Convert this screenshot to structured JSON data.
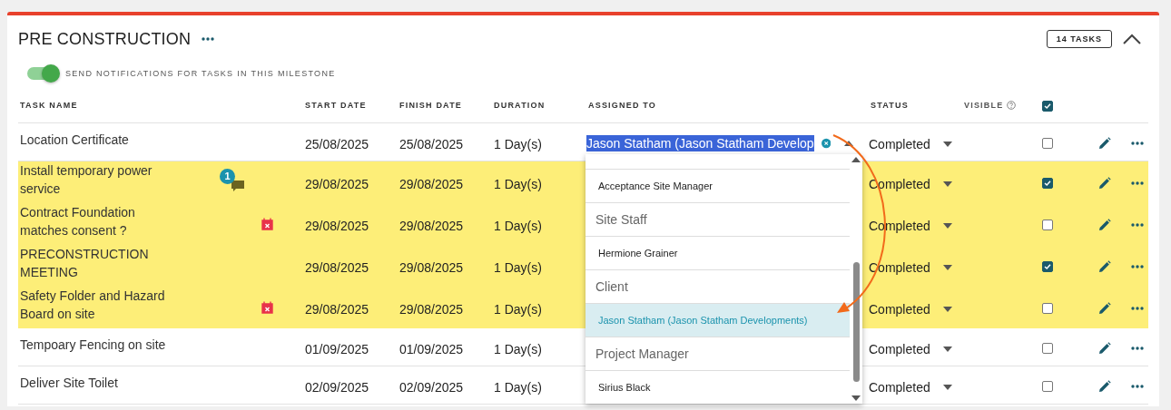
{
  "milestone": {
    "title": "PRE CONSTRUCTION",
    "task_count": "14 TASKS",
    "expanded": true
  },
  "notifications": {
    "label": "SEND NOTIFICATIONS FOR TASKS IN THIS MILESTONE",
    "on": true
  },
  "table": {
    "columns": [
      "TASK NAME",
      "START DATE",
      "FINISH DATE",
      "DURATION",
      "ASSIGNED TO",
      "STATUS",
      "VISIBLE"
    ],
    "visible_all_checked": true,
    "rows": [
      {
        "name": "Location Certificate",
        "start": "25/08/2025",
        "finish": "25/08/2025",
        "duration": "1 Day(s)",
        "status": "Completed",
        "visible": false,
        "highlighted": false,
        "kind": "plain",
        "assigned": "Jason Statham (Jason Statham Develop"
      },
      {
        "name": "Install temporary power service",
        "start": "29/08/2025",
        "finish": "29/08/2025",
        "duration": "1 Day(s)",
        "status": "Completed",
        "visible": true,
        "highlighted": true,
        "kind": "commented",
        "comment_count": "1"
      },
      {
        "name": "Contract Foundation matches consent ?",
        "start": "29/08/2025",
        "finish": "29/08/2025",
        "duration": "1 Day(s)",
        "status": "Completed",
        "visible": false,
        "highlighted": true,
        "kind": "overdue"
      },
      {
        "name": "PRECONSTRUCTION MEETING",
        "start": "29/08/2025",
        "finish": "29/08/2025",
        "duration": "1 Day(s)",
        "status": "Completed",
        "visible": true,
        "highlighted": true,
        "kind": "plain"
      },
      {
        "name": "Safety Folder and Hazard Board on site",
        "start": "29/08/2025",
        "finish": "29/08/2025",
        "duration": "1 Day(s)",
        "status": "Completed",
        "visible": false,
        "highlighted": true,
        "kind": "overdue"
      },
      {
        "name": "Tempoary Fencing on site",
        "start": "01/09/2025",
        "finish": "01/09/2025",
        "duration": "1 Day(s)",
        "status": "Completed",
        "visible": false,
        "highlighted": false,
        "kind": "plain"
      },
      {
        "name": "Deliver Site Toilet",
        "start": "02/09/2025",
        "finish": "02/09/2025",
        "duration": "1 Day(s)",
        "status": "Completed",
        "visible": false,
        "highlighted": false,
        "kind": "plain"
      }
    ]
  },
  "assignee_dropdown": {
    "items": [
      {
        "kind": "option",
        "label": "Acceptance Site Manager",
        "selected": false
      },
      {
        "kind": "group",
        "label": "Site Staff"
      },
      {
        "kind": "option",
        "label": "Hermione Grainer",
        "selected": false
      },
      {
        "kind": "group",
        "label": "Client"
      },
      {
        "kind": "option",
        "label": "Jason Statham (Jason Statham Developments)",
        "selected": true
      },
      {
        "kind": "group",
        "label": "Project Manager"
      },
      {
        "kind": "option",
        "label": "Sirius Black",
        "selected": false
      }
    ]
  }
}
